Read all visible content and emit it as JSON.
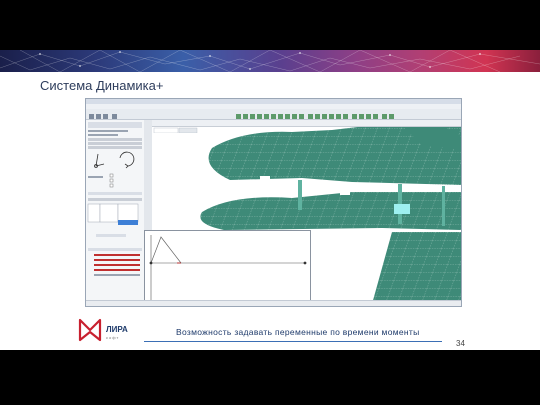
{
  "slide": {
    "title": "Система Динамика+",
    "caption": "Возможность задавать переменные по времени моменты",
    "page_number": "34"
  },
  "logo": {
    "name": "ЛИРА",
    "sub": "софт"
  },
  "colors": {
    "model_fill": "#3e8a78",
    "model_grid": "#b9d8cf",
    "highlight_panel": "#9ef0f0",
    "footer_line": "#3b6fb5",
    "title_text": "#2e3d5c",
    "logo_red": "#c8202f"
  }
}
